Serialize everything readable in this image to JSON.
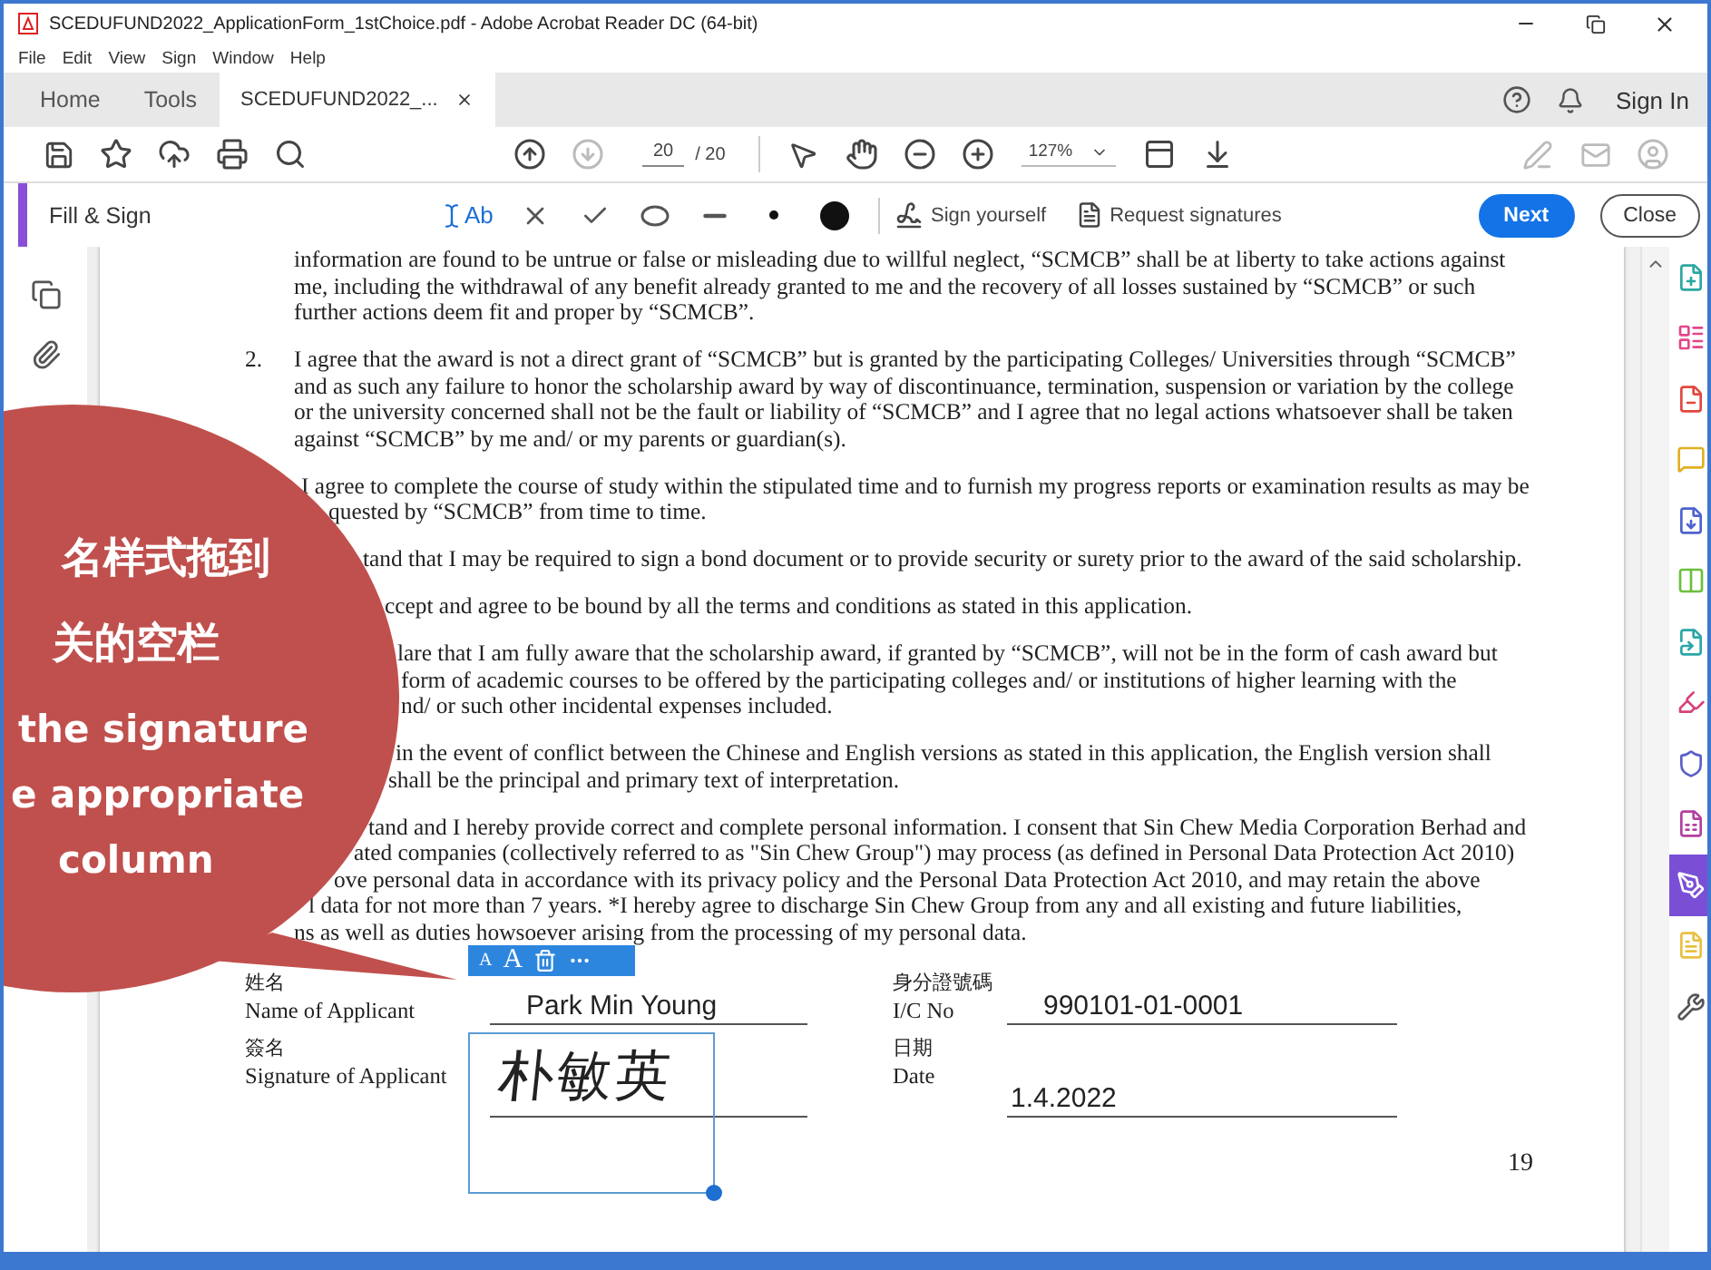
{
  "window": {
    "title": "SCEDUFUND2022_ApplicationForm_1stChoice.pdf - Adobe Acrobat Reader DC (64-bit)"
  },
  "menu": [
    "File",
    "Edit",
    "View",
    "Sign",
    "Window",
    "Help"
  ],
  "tabs": [
    {
      "label": "Home",
      "selected": false,
      "closable": false
    },
    {
      "label": "Tools",
      "selected": false,
      "closable": false
    },
    {
      "label": "SCEDUFUND2022_...",
      "selected": true,
      "closable": true
    }
  ],
  "account": {
    "sign_in": "Sign In"
  },
  "toolbar": {
    "page": "20",
    "page_total": "/ 20",
    "zoom": "127%"
  },
  "fill_sign": {
    "title": "Fill & Sign",
    "text_tool": "Ab",
    "sign_yourself": "Sign yourself",
    "request_signatures": "Request signatures",
    "next": "Next",
    "close": "Close"
  },
  "document": {
    "paragraphs": [
      {
        "lines": [
          "information are found to be untrue or false or misleading due to willful neglect, “SCMCB” shall be at liberty to take actions against",
          "me, including the withdrawal of any benefit already granted to me and the recovery of all losses sustained by “SCMCB” or such",
          "further actions deem fit and proper by “SCMCB”."
        ]
      },
      {
        "number": "2.",
        "lines": [
          "I agree that the award is not a direct grant of “SCMCB” but is granted by the participating Colleges/ Universities through “SCMCB”",
          "and as such any failure to honor the scholarship award by way of discontinuance, termination, suspension or variation by the college",
          "or the university concerned shall not be the fault or liability of “SCMCB” and I agree that no legal actions whatsoever shall be taken",
          "against “SCMCB” by me and/ or my parents or guardian(s)."
        ]
      },
      {
        "lines": [
          "I agree to complete the course of study within the stipulated time and to furnish my progress reports or examination results as may be",
          "quested by “SCMCB” from time to time."
        ]
      },
      {
        "lines": [
          "tand that I may be required to sign a bond document or to provide security or surety prior to the award of the said scholarship."
        ]
      },
      {
        "lines": [
          "ccept and agree to be bound by all the terms and conditions as stated in this application."
        ]
      },
      {
        "lines": [
          "lare that I am fully aware that the scholarship award, if granted by “SCMCB”, will not be in the form of cash award but",
          "form of academic courses to be offered by the participating colleges and/ or institutions of higher learning with the",
          "nd/ or such other incidental expenses included."
        ]
      },
      {
        "lines": [
          "in the event of conflict between the Chinese and English versions as stated in this application, the English version shall",
          "shall be the principal and primary text of interpretation."
        ]
      },
      {
        "lines": [
          "tand and I hereby provide correct and complete personal information. I consent that Sin Chew Media Corporation Berhad and",
          "ated companies (collectively referred to as \"Sin Chew Group\") may process (as defined in Personal Data Protection Act 2010)",
          "ove personal data in accordance with its privacy policy and the Personal Data Protection Act 2010, and may retain the above",
          "l data for not more than 7 years. *I hereby agree to discharge Sin Chew Group from any and all existing and future liabilities,",
          "ns as well as duties howsoever arising from the processing of my personal data."
        ]
      }
    ],
    "form": [
      [
        {
          "label_zh": "姓名",
          "label_en": "Name of Applicant",
          "value": "Park Min Young",
          "kind": "typed"
        },
        {
          "label_zh": "身分證號碼",
          "label_en": "I/C No",
          "value": "990101-01-0001",
          "kind": "typed"
        }
      ],
      [
        {
          "label_zh": "簽名",
          "label_en": "Signature of Applicant",
          "value": "朴敏英",
          "kind": "handwriting"
        },
        {
          "label_zh": "日期",
          "label_en": "Date",
          "value": "1.4.2022",
          "kind": "typed"
        }
      ]
    ],
    "page_number": "19"
  },
  "selection_toolbar": {
    "smaller": "A",
    "larger": "A"
  },
  "callout": {
    "lines": [
      {
        "text": "名样式拖到",
        "kind": "zh"
      },
      {
        "text": "关的空栏",
        "kind": "zh"
      },
      {
        "text": "the signature",
        "kind": "en"
      },
      {
        "text": "e appropriate",
        "kind": "en"
      },
      {
        "text": "column",
        "kind": "en"
      }
    ]
  },
  "tools_panel": [
    {
      "color": "#2aa7a0",
      "selected": false
    },
    {
      "color": "#e4458a",
      "selected": false
    },
    {
      "color": "#e2473c",
      "selected": false
    },
    {
      "color": "#e0b020",
      "selected": false
    },
    {
      "color": "#4e62d0",
      "selected": false
    },
    {
      "color": "#6bbf3c",
      "selected": false
    },
    {
      "color": "#2ba6a6",
      "selected": false
    },
    {
      "color": "#d8407a",
      "selected": false
    },
    {
      "color": "#5b5fc7",
      "selected": false
    },
    {
      "color": "#b43fa0",
      "selected": false
    },
    {
      "color": "#7a4fd6",
      "selected": true
    },
    {
      "color": "#e8c040",
      "selected": false
    },
    {
      "color": "#555555",
      "selected": false
    }
  ]
}
